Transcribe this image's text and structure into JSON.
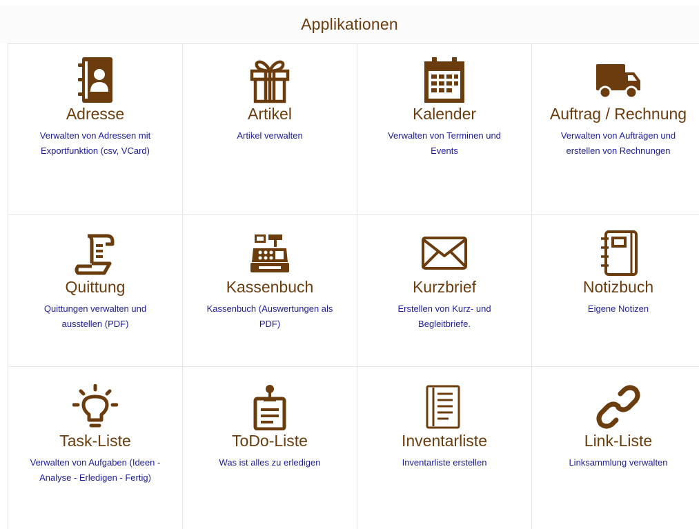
{
  "header": {
    "title": "Applikationen"
  },
  "tiles": [
    {
      "title": "Adresse",
      "desc": "Verwalten von Adressen mit Exportfunktion (csv, VCard)",
      "icon": "address-book-icon"
    },
    {
      "title": "Artikel",
      "desc": "Artikel verwalten",
      "icon": "gift-icon"
    },
    {
      "title": "Kalender",
      "desc": "Verwalten von Terminen und Events",
      "icon": "calendar-icon"
    },
    {
      "title": "Auftrag / Rechnung",
      "desc": "Verwalten von Aufträgen und erstellen von Rechnungen",
      "icon": "truck-icon"
    },
    {
      "title": "Quittung",
      "desc": "Quittungen verwalten und ausstellen (PDF)",
      "icon": "receipt-scroll-icon"
    },
    {
      "title": "Kassenbuch",
      "desc": "Kassenbuch (Auswertungen als PDF)",
      "icon": "cash-register-icon"
    },
    {
      "title": "Kurzbrief",
      "desc": "Erstellen von Kurz- und Begleitbriefe.",
      "icon": "envelope-icon"
    },
    {
      "title": "Notizbuch",
      "desc": "Eigene Notizen",
      "icon": "notebook-icon"
    },
    {
      "title": "Task-Liste",
      "desc": "Verwalten von Aufgaben (Ideen - Analyse - Erledigen - Fertig)",
      "icon": "lightbulb-icon"
    },
    {
      "title": "ToDo-Liste",
      "desc": "Was ist alles zu erledigen",
      "icon": "clipboard-pin-icon"
    },
    {
      "title": "Inventarliste",
      "desc": "Inventarliste erstellen",
      "icon": "list-document-icon"
    },
    {
      "title": "Link-Liste",
      "desc": "Linksammlung verwalten",
      "icon": "link-icon"
    }
  ],
  "colors": {
    "accent": "#6b3d0e",
    "description": "#1c1c99",
    "border": "#e4e4e4"
  }
}
